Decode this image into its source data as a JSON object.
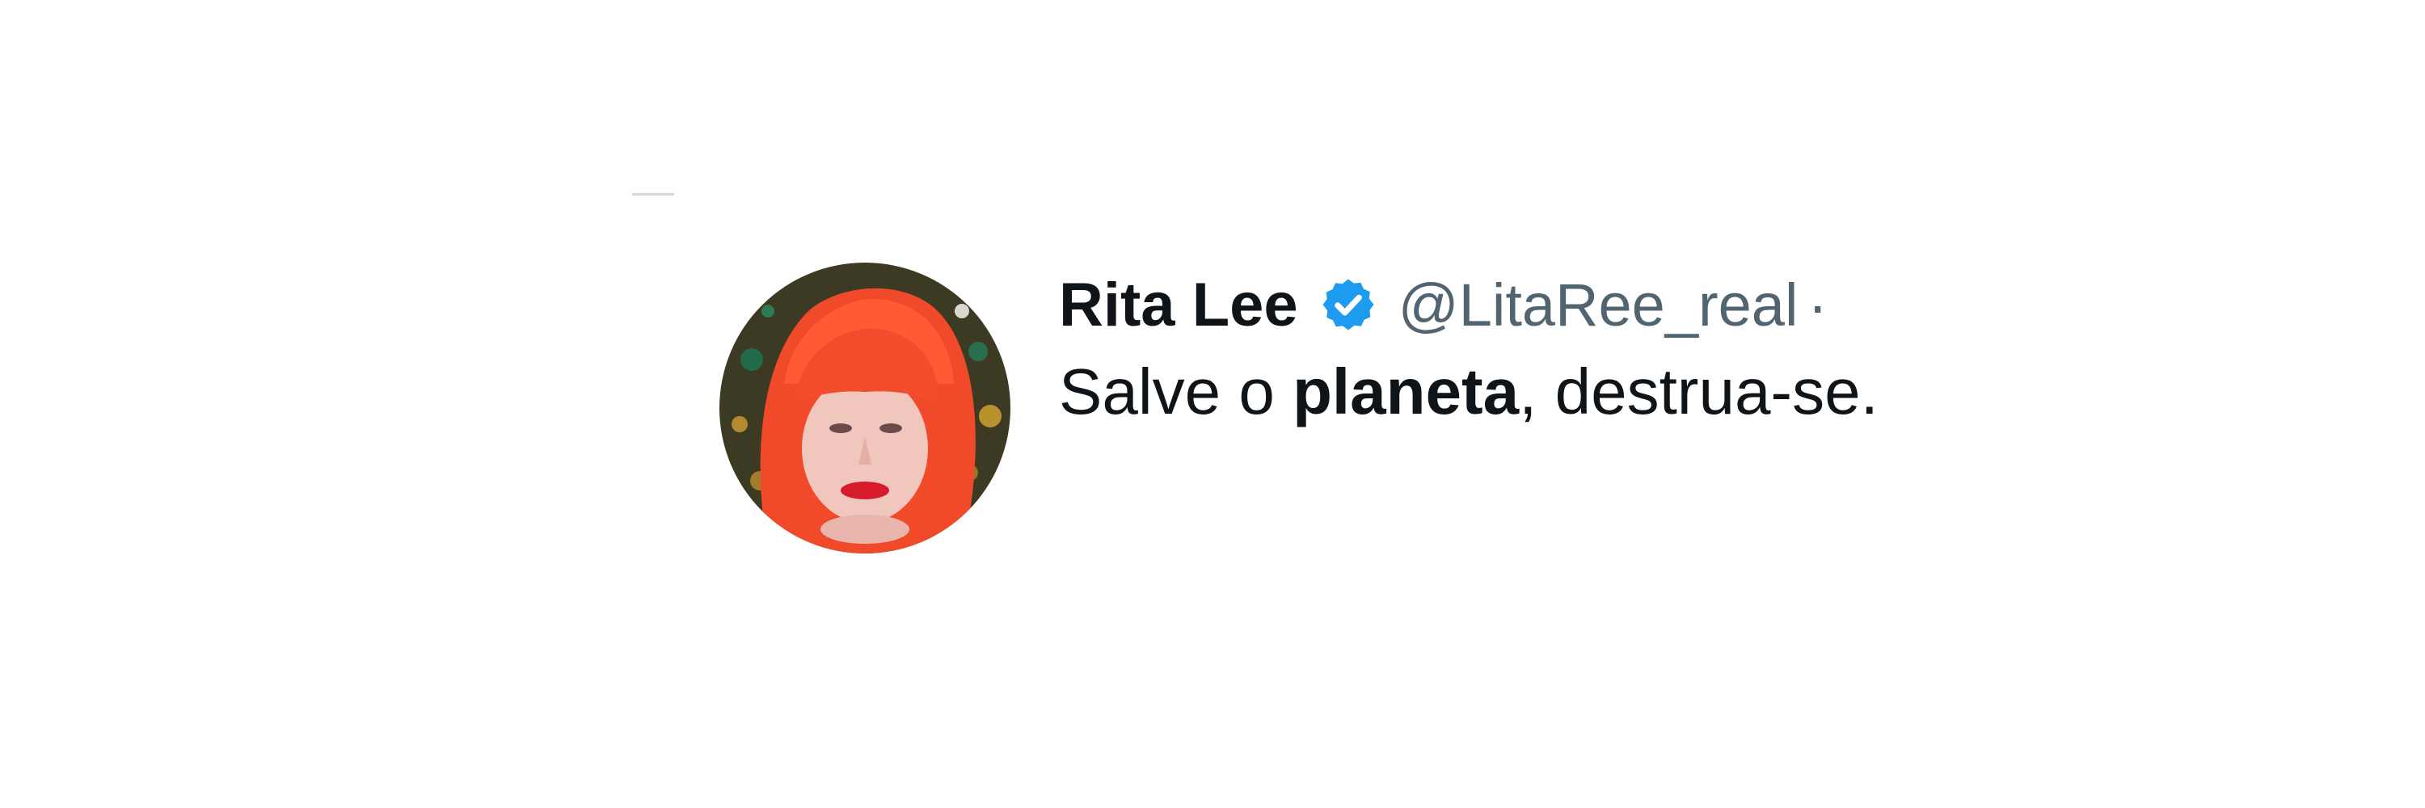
{
  "tweet": {
    "author": {
      "display_name": "Rita Lee",
      "handle": "@LitaRee_real",
      "separator": "·",
      "verified": true,
      "verified_badge_color": "#1d9bf0",
      "avatar_icon": "profile-photo-red-hair"
    },
    "text": {
      "before": "Salve o ",
      "bold": "planeta",
      "after": ", destrua-se."
    }
  },
  "colors": {
    "name_text": "#0f1419",
    "handle_text": "#536471",
    "background": "#ffffff"
  }
}
